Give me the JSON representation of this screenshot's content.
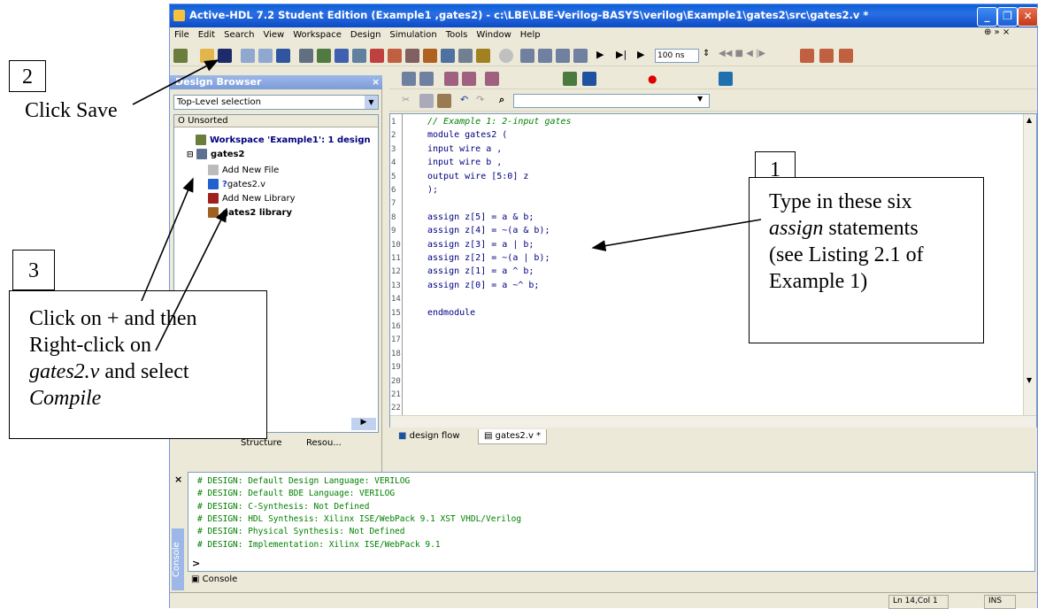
{
  "window": {
    "title": "Active-HDL 7.2 Student Edition (Example1 ,gates2) - c:\\LBE\\LBE-Verilog-BASYS\\verilog\\Example1\\gates2\\src\\gates2.v *",
    "min": "_",
    "max": "❐",
    "close": "✕"
  },
  "menu": [
    "File",
    "Edit",
    "Search",
    "View",
    "Workspace",
    "Design",
    "Simulation",
    "Tools",
    "Window",
    "Help"
  ],
  "toolbar": {
    "sim_time": "100 ns"
  },
  "design_browser": {
    "title": "Design Browser",
    "selection": "Top-Level selection",
    "column": "Unsorted",
    "items": [
      {
        "label": "Workspace 'Example1': 1 design"
      },
      {
        "label": "gates2"
      },
      {
        "label": "Add New File"
      },
      {
        "label": "gates2.v",
        "prefix": "?"
      },
      {
        "label": "Add New Library"
      },
      {
        "label": "gates2 library"
      }
    ],
    "tabs": [
      "Structure",
      "Resou..."
    ]
  },
  "editor": {
    "lines": [
      {
        "n": "1",
        "text": "// Example 1: 2-input gates",
        "type": "comment"
      },
      {
        "n": "2",
        "text": "module gates2 (",
        "type": "code"
      },
      {
        "n": "3",
        "text": "input wire a ,",
        "type": "code"
      },
      {
        "n": "4",
        "text": "input wire b ,",
        "type": "code"
      },
      {
        "n": "5",
        "text": "output wire [5:0] z",
        "type": "code"
      },
      {
        "n": "6",
        "text": ");",
        "type": "code"
      },
      {
        "n": "7",
        "text": "",
        "type": "code"
      },
      {
        "n": "8",
        "text": "assign z[5] = a & b;",
        "type": "code"
      },
      {
        "n": "9",
        "text": "assign z[4] = ~(a & b);",
        "type": "code"
      },
      {
        "n": "10",
        "text": "assign z[3] = a | b;",
        "type": "code"
      },
      {
        "n": "11",
        "text": "assign z[2] = ~(a | b);",
        "type": "code"
      },
      {
        "n": "12",
        "text": "assign z[1] = a ^ b;",
        "type": "code"
      },
      {
        "n": "13",
        "text": "assign z[0] = a ~^ b;",
        "type": "code"
      },
      {
        "n": "14",
        "text": "",
        "type": "code"
      },
      {
        "n": "15",
        "text": "endmodule",
        "type": "code"
      },
      {
        "n": "16",
        "text": "",
        "type": "code"
      },
      {
        "n": "17",
        "text": "",
        "type": "code"
      },
      {
        "n": "18",
        "text": "",
        "type": "code"
      },
      {
        "n": "19",
        "text": "",
        "type": "code"
      },
      {
        "n": "20",
        "text": "",
        "type": "code"
      },
      {
        "n": "21",
        "text": "",
        "type": "code"
      },
      {
        "n": "22",
        "text": "",
        "type": "code"
      }
    ],
    "tabs": [
      "design flow",
      "gates2.v *"
    ]
  },
  "console": {
    "label": "Console",
    "lines": [
      "# DESIGN: Default Design Language: VERILOG",
      "# DESIGN: Default BDE Language: VERILOG",
      "# DESIGN: C-Synthesis: Not Defined",
      "# DESIGN: HDL Synthesis: Xilinx ISE/WebPack 9.1 XST VHDL/Verilog",
      "# DESIGN: Physical Synthesis: Not Defined",
      "# DESIGN: Implementation: Xilinx ISE/WebPack 9.1"
    ],
    "prompt": ">",
    "tab": "Console"
  },
  "status": {
    "position": "Ln 14,Col 1",
    "mode": "INS"
  },
  "annotations": {
    "step2_num": "2",
    "step2_text": "Click Save",
    "step1_num": "1",
    "step1_line1": "Type in these six",
    "step1_line2_em": "assign",
    "step1_line2_rest": " statements",
    "step1_line3": "(see Listing 2.1 of",
    "step1_line4": "Example 1)",
    "step3_num": "3",
    "step3_line1": "Click on + and then",
    "step3_line2": "Right-click on",
    "step3_line3_em": "gates2.v",
    "step3_line3_rest": " and select",
    "step3_line4_em": "Compile"
  }
}
